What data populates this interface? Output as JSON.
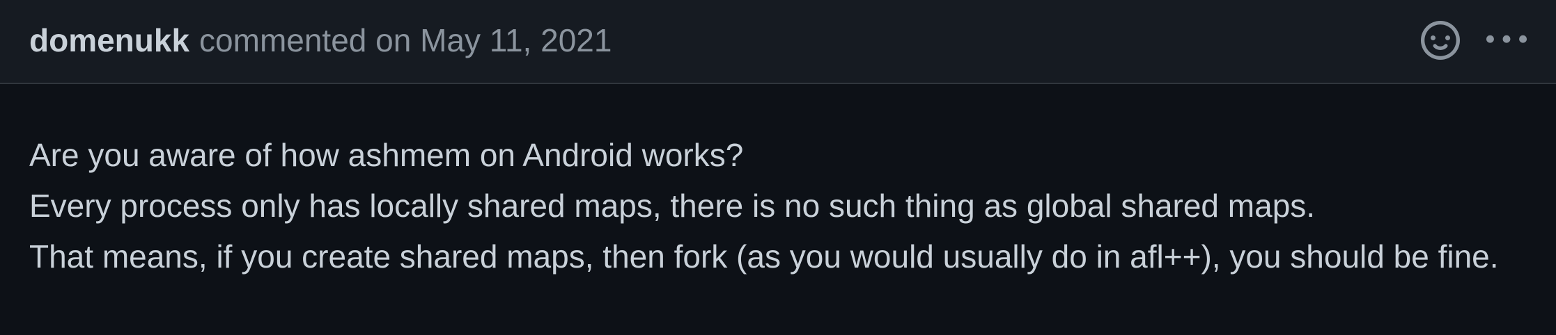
{
  "comment": {
    "author": "domenukk",
    "action": "commented",
    "date": "on May 11, 2021",
    "icons": {
      "reaction": "smiley-icon",
      "menu": "kebab-horizontal-icon"
    },
    "body_lines": [
      "Are you aware of how ashmem on Android works?",
      "Every process only has locally shared maps, there is no such thing as global shared maps.",
      "That means, if you create shared maps, then fork (as you would usually do in afl++), you should be fine."
    ]
  },
  "colors": {
    "background": "#0d1117",
    "header_background": "#161b22",
    "border": "#30363d",
    "text": "#c9d1d9",
    "muted_text": "#8b949e"
  }
}
